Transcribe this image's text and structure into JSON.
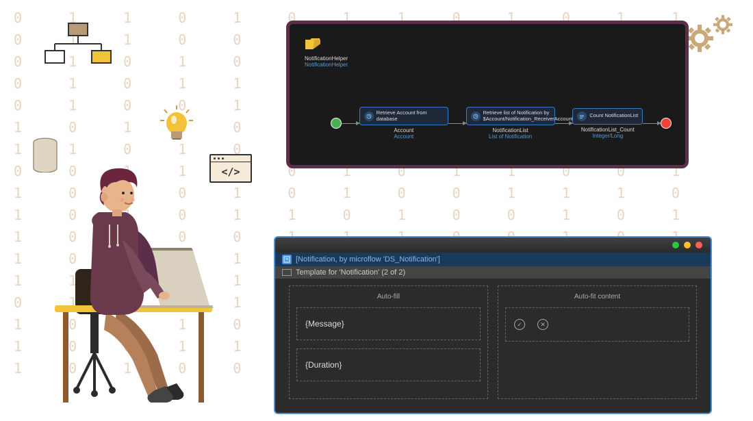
{
  "microflow": {
    "entity_label": "NotificationHelper",
    "entity_link": "NotificationHelper",
    "nodes": [
      {
        "title": "Retrieve Account from database",
        "var_label": "Account",
        "var_type": "Account"
      },
      {
        "title": "Retrieve list of Notification by $Account/Notification_ReceiverAccount",
        "var_label": "NotificationList",
        "var_type": "List of Notification"
      },
      {
        "title": "Count NotificationList",
        "var_label": "NotificationList_Count",
        "var_type": "Integer/Long"
      }
    ]
  },
  "template": {
    "header": "[Notification, by microflow 'DS_Notification']",
    "subheader": "Template for 'Notification' (2 of 2)",
    "col_autofill": "Auto-fill",
    "col_autofit": "Auto-fit content",
    "field_message": "{Message}",
    "field_duration": "{Duration}"
  },
  "icons": {
    "code_tags": "</>",
    "check": "✓",
    "cross": "✕"
  },
  "binary_pattern": "0 1 1 0 1 0 1 1 0 1 0 1\n1 0 1 1 0 0 1 0 1 0 1 0\n0 1 0 1 0 1 0 0 1 0 1 1\n1 1 0 0 1 0 1 1 0 1 0 0\n0 0 1 1 0 1 0 0 1 1 0 1\n1 0 1 0 1 1 0 1 0 0 1 1\n0 1 0 1 0 0 1 1 0 1 0 1\n1 1 1 0 1 0 1 0 0 1 1 0\n0 1 0 1 1 0 0 1 1 0 1 0\n1 0 1 0 0 1 1 1 0 1 0 1\n0 1 1 0 1 0 0 1 0 1 1 0\n1 0 0 1 1 1 0 0 1 0 1 1\n0 1 0 1 0 1 1 0 1 1 0 0\n1 1 0 0 1 0 1 1 0 0 1 0\n0 0 1 1 0 1 0 0 1 1 0 1\n1 0 1 0 1 1 0 1 0 0 1 1\n0 1 0 1 0 0 1 1 0 1 0 1\n1 1 1 0 1 0 1 0 0 1 1 0"
}
